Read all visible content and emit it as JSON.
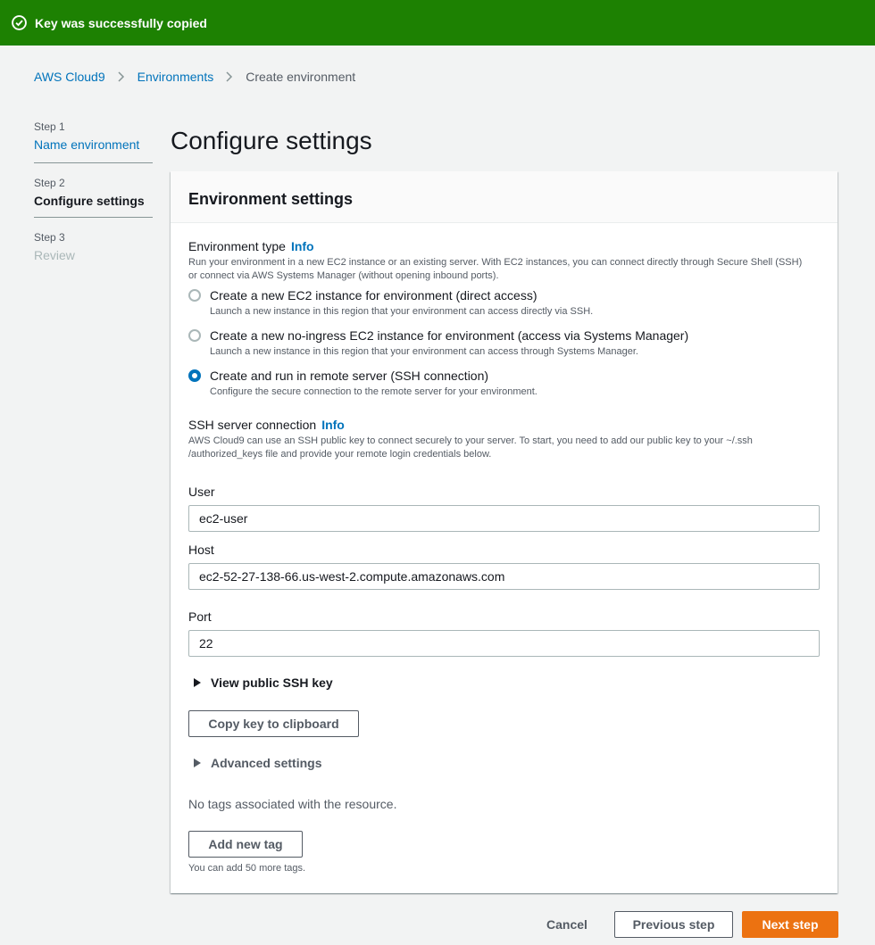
{
  "flash": {
    "message": "Key was successfully copied",
    "icon": "check-circle-icon",
    "color": "#1d8102"
  },
  "breadcrumb": {
    "items": [
      "AWS Cloud9",
      "Environments",
      "Create environment"
    ]
  },
  "steps": [
    {
      "num": "Step 1",
      "title": "Name environment"
    },
    {
      "num": "Step 2",
      "title": "Configure settings"
    },
    {
      "num": "Step 3",
      "title": "Review"
    }
  ],
  "page": {
    "title": "Configure settings"
  },
  "card": {
    "header": "Environment settings",
    "env_type": {
      "label": "Environment type",
      "info": "Info",
      "description": "Run your environment in a new EC2 instance or an existing server. With EC2 instances, you can connect directly through Secure Shell (SSH) or connect via AWS Systems Manager (without opening inbound ports).",
      "options": [
        {
          "label": "Create a new EC2 instance for environment (direct access)",
          "desc": "Launch a new instance in this region that your environment can access directly via SSH.",
          "checked": false
        },
        {
          "label": "Create a new no-ingress EC2 instance for environment (access via Systems Manager)",
          "desc": "Launch a new instance in this region that your environment can access through Systems Manager.",
          "checked": false
        },
        {
          "label": "Create and run in remote server (SSH connection)",
          "desc": "Configure the secure connection to the remote server for your environment.",
          "checked": true
        }
      ]
    },
    "ssh": {
      "label": "SSH server connection",
      "info": "Info",
      "description": "AWS Cloud9 can use an SSH public key to connect securely to your server. To start, you need to add our public key to your ~/.ssh /authorized_keys file and provide your remote login credentials below."
    },
    "user": {
      "label": "User",
      "value": "ec2-user"
    },
    "host": {
      "label": "Host",
      "value": "ec2-52-27-138-66.us-west-2.compute.amazonaws.com"
    },
    "port": {
      "label": "Port",
      "value": "22"
    },
    "view_key": "View public SSH key",
    "copy_button": "Copy key to clipboard",
    "advanced": "Advanced settings",
    "tags": {
      "empty": "No tags associated with the resource.",
      "add_button": "Add new tag",
      "hint": "You can add 50 more tags."
    }
  },
  "footer": {
    "cancel": "Cancel",
    "previous": "Previous step",
    "next": "Next step"
  },
  "colors": {
    "link": "#0073bb",
    "primary": "#ec7211",
    "success": "#1d8102"
  }
}
